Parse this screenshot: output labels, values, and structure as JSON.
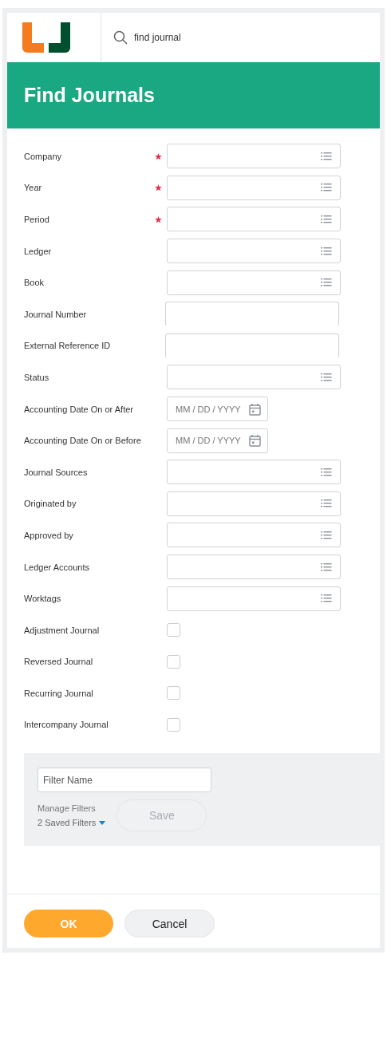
{
  "search": {
    "value": "find journal"
  },
  "page_title": "Find Journals",
  "fields": [
    {
      "label": "Company",
      "kind": "prompt",
      "required": true
    },
    {
      "label": "Year",
      "kind": "prompt",
      "required": true
    },
    {
      "label": "Period",
      "kind": "prompt",
      "required": true
    },
    {
      "label": "Ledger",
      "kind": "prompt",
      "required": false
    },
    {
      "label": "Book",
      "kind": "prompt",
      "required": false
    },
    {
      "label": "Journal Number",
      "kind": "text",
      "required": false
    },
    {
      "label": "External Reference ID",
      "kind": "text",
      "required": false
    },
    {
      "label": "Status",
      "kind": "prompt",
      "required": false
    },
    {
      "label": "Accounting Date On or After",
      "kind": "date",
      "required": false,
      "placeholder": "MM / DD / YYYY"
    },
    {
      "label": "Accounting Date On or Before",
      "kind": "date",
      "required": false,
      "placeholder": "MM / DD / YYYY"
    },
    {
      "label": "Journal Sources",
      "kind": "prompt",
      "required": false
    },
    {
      "label": "Originated by",
      "kind": "prompt",
      "required": false
    },
    {
      "label": "Approved by",
      "kind": "prompt",
      "required": false
    },
    {
      "label": "Ledger Accounts",
      "kind": "prompt",
      "required": false
    },
    {
      "label": "Worktags",
      "kind": "prompt",
      "required": false
    },
    {
      "label": "Adjustment Journal",
      "kind": "checkbox",
      "required": false,
      "checked": false
    },
    {
      "label": "Reversed Journal",
      "kind": "checkbox",
      "required": false,
      "checked": false
    },
    {
      "label": "Recurring Journal",
      "kind": "checkbox",
      "required": false,
      "checked": false
    },
    {
      "label": "Intercompany Journal",
      "kind": "checkbox",
      "required": false,
      "checked": false
    }
  ],
  "filters": {
    "name_placeholder": "Filter Name",
    "manage_label": "Manage Filters",
    "saved_label": "2 Saved Filters",
    "save_button": {
      "label": "Save",
      "disabled": true
    }
  },
  "buttons": [
    {
      "label": "OK",
      "kind": "primary"
    },
    {
      "label": "Cancel",
      "kind": "secondary"
    }
  ]
}
